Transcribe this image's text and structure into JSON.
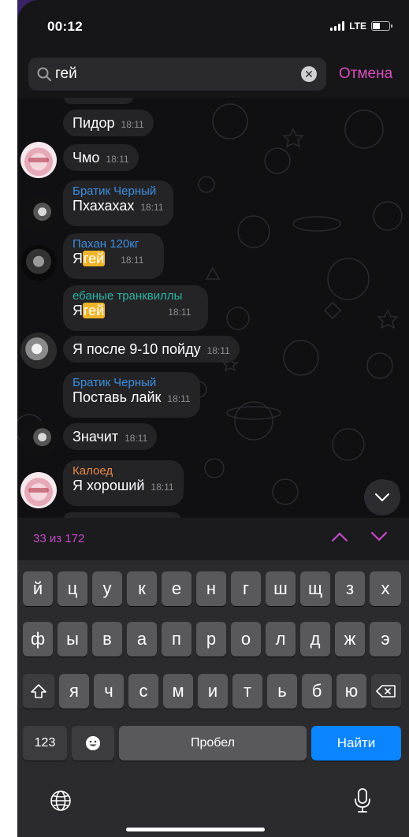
{
  "status_bar": {
    "time": "00:12",
    "network": "LTE",
    "battery_level": 0.45
  },
  "search": {
    "query": "гей",
    "cancel_label": "Отмена"
  },
  "messages": [
    {
      "text": "Пидор",
      "time": "18:11"
    },
    {
      "text": "Чмо",
      "time": "18:11"
    },
    {
      "sender": "Братик Черный",
      "text": "Пхахахах",
      "time": "18:11"
    },
    {
      "sender": "Пахан 120кг",
      "text_before": "Я",
      "highlight": "гей",
      "time": "18:11"
    },
    {
      "sender": "ебаные транквиллы",
      "text_before": "Я",
      "highlight": "гей",
      "time": "18:11"
    },
    {
      "text": "Я после 9-10 пойду",
      "time": "18:11"
    },
    {
      "sender": "Братик Черный",
      "text": "Поставь лайк",
      "time": "18:11"
    },
    {
      "text": "Значит",
      "time": "18:11"
    },
    {
      "sender": "Калоед",
      "text": "Я хороший",
      "time": "18:11"
    }
  ],
  "results": {
    "counter": "33 из 172"
  },
  "keyboard": {
    "row1": [
      "й",
      "ц",
      "у",
      "к",
      "е",
      "н",
      "г",
      "ш",
      "щ",
      "з",
      "х"
    ],
    "row2": [
      "ф",
      "ы",
      "в",
      "а",
      "п",
      "р",
      "о",
      "л",
      "д",
      "ж",
      "э"
    ],
    "row3": [
      "я",
      "ч",
      "с",
      "м",
      "и",
      "т",
      "ь",
      "б",
      "ю"
    ],
    "numbers_label": "123",
    "space_label": "Пробел",
    "go_label": "Найти"
  },
  "colors": {
    "accent_pink": "#d84fbd",
    "counter_purple": "#c549c9",
    "highlight": "#f0b429",
    "sender_blue": "#3d8fe0",
    "sender_teal": "#2bb5a0",
    "sender_orange": "#e8894a",
    "go_key": "#0a84ff"
  }
}
